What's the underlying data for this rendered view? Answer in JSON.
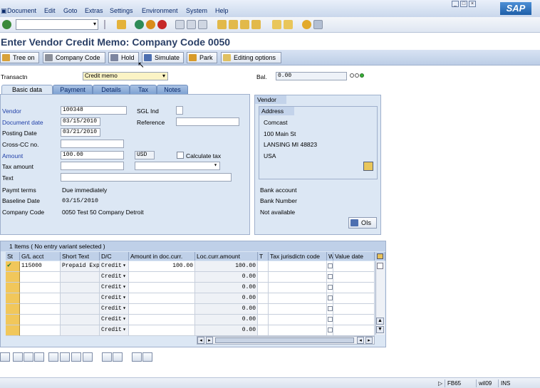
{
  "menu": [
    "Document",
    "Edit",
    "Goto",
    "Extras",
    "Settings",
    "Environment",
    "System",
    "Help"
  ],
  "logo": "SAP",
  "title": "Enter Vendor Credit Memo: Company Code 0050",
  "app_toolbar": {
    "tree_on": "Tree on",
    "company_code": "Company Code",
    "hold": "Hold",
    "simulate": "Simulate",
    "park": "Park",
    "editing_options": "Editing options"
  },
  "header": {
    "transaction_label": "Transactn",
    "transaction_value": "Credit memo",
    "balance_label": "Bal.",
    "balance_value": "0.00"
  },
  "tabs": [
    "Basic data",
    "Payment",
    "Details",
    "Tax",
    "Notes"
  ],
  "basic": {
    "vendor_label": "Vendor",
    "vendor_value": "100348",
    "sgl_label": "SGL Ind",
    "doc_date_label": "Document date",
    "doc_date_value": "03/15/2010",
    "reference_label": "Reference",
    "posting_date_label": "Posting Date",
    "posting_date_value": "03/21/2010",
    "cross_cc_label": "Cross-CC no.",
    "amount_label": "Amount",
    "amount_value": "100.00",
    "currency": "USD",
    "calc_tax_label": "Calculate tax",
    "tax_amount_label": "Tax amount",
    "text_label": "Text",
    "payt_terms_label": "Paymt terms",
    "payt_terms_value": "Due immediately",
    "baseline_label": "Baseline Date",
    "baseline_value": "03/15/2010",
    "company_code_label": "Company Code",
    "company_code_value": "0050 Test 50 Company Detroit"
  },
  "vendor_panel": {
    "title": "Vendor",
    "address_title": "Address",
    "address_lines": [
      "Comcast",
      "100 Main St",
      "LANSING MI  48823",
      "USA"
    ],
    "bank_account": "Bank account",
    "bank_number": "Bank Number",
    "not_available": "Not available",
    "ois_label": "OIs"
  },
  "items": {
    "caption": "1 Items ( No entry variant selected )",
    "columns": [
      "St",
      "G/L acct",
      "Short Text",
      "D/C",
      "Amount in doc.curr.",
      "Loc.curr.amount",
      "T",
      "Tax jurisdictn code",
      "W",
      "Value date"
    ],
    "rows": [
      {
        "gl": "115000",
        "text": "Prepaid Expe",
        "dc": "Credit",
        "amount": "100.00",
        "loc": "100.00"
      },
      {
        "gl": "",
        "text": "",
        "dc": "Credit",
        "amount": "",
        "loc": "0.00"
      },
      {
        "gl": "",
        "text": "",
        "dc": "Credit",
        "amount": "",
        "loc": "0.00"
      },
      {
        "gl": "",
        "text": "",
        "dc": "Credit",
        "amount": "",
        "loc": "0.00"
      },
      {
        "gl": "",
        "text": "",
        "dc": "Credit",
        "amount": "",
        "loc": "0.00"
      },
      {
        "gl": "",
        "text": "",
        "dc": "Credit",
        "amount": "",
        "loc": "0.00"
      },
      {
        "gl": "",
        "text": "",
        "dc": "Credit",
        "amount": "",
        "loc": "0.00"
      }
    ]
  },
  "status": {
    "tcode": "FB65",
    "server": "wil09",
    "mode": "INS"
  }
}
